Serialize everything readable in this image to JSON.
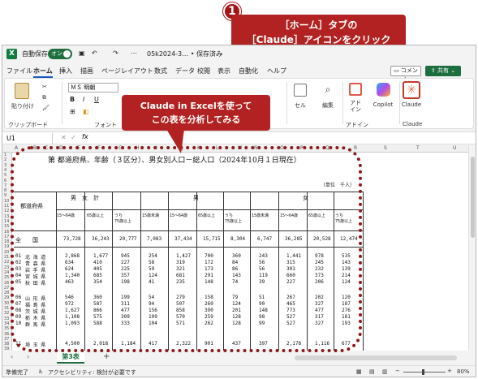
{
  "callout_main": {
    "badge": "1",
    "line1": "［ホーム］タブの",
    "line2": "［Claude］アイコンをクリック"
  },
  "callout_sub": {
    "line1": "Claude in Excelを使って",
    "line2": "この表を分析してみる"
  },
  "titlebar": {
    "autosave": "自動保存",
    "toggle": "オン",
    "filename": "05k2024-3… • 保存済み",
    "dropdown": "⌄"
  },
  "menu": {
    "items": [
      "ファイル",
      "ホーム",
      "挿入",
      "描画",
      "ページレイアウト",
      "数式",
      "データ",
      "校閲",
      "表示",
      "自動化",
      "ヘルプ"
    ],
    "comment": "コメント",
    "share": "共有"
  },
  "ribbon": {
    "paste": "貼り付け",
    "clipboard": "クリップボード",
    "font_name": "ＭＳ 明朝",
    "font_group": "フォント",
    "cells": "セル",
    "editing": "編集",
    "addins": "アド\nイン",
    "copilot": "Copilot",
    "claude": "Claude",
    "addins_group": "アドイン",
    "claude_group": "Claude"
  },
  "formula": {
    "namebox": "U1",
    "fx": "fx"
  },
  "columns": [
    "A",
    "B",
    "C",
    "D",
    "E",
    "F",
    "G",
    "H",
    "I",
    "J",
    "K",
    "L",
    "M",
    "N",
    "O",
    "P",
    "Q",
    "R",
    "S",
    "T",
    "U"
  ],
  "rows": [
    "1",
    "2",
    "3",
    "4",
    "5",
    "6",
    "7",
    "8",
    "9",
    "10",
    "11",
    "12",
    "13",
    "14",
    "15",
    "16",
    "17",
    "18",
    "19",
    "20",
    "21",
    "22",
    "23",
    "24",
    "25",
    "26",
    "27",
    "28",
    "29",
    "30",
    "31",
    "32",
    "33",
    "34",
    "35",
    "36",
    "37",
    "38",
    "39"
  ],
  "table": {
    "title": "第 都道府県、年齢（３区分）、男女別人口－総人口（2024年10月１日現在）",
    "unit": "（単位　千人）",
    "header_pref": "都道府県",
    "header_total": "男　女　計",
    "header_male": "男",
    "header_female": "女",
    "sub": [
      "15～64歳",
      "65歳以上",
      "うち\n75歳以上",
      "15歳未満",
      "15～64歳",
      "65歳以上",
      "うち\n75歳以上",
      "15歳未満",
      "15～64歳",
      "65歳以上",
      "うち\n75歳以上"
    ],
    "national": {
      "name": "全　　国",
      "values": [
        "73,728",
        "36,243",
        "20,777",
        "7,083",
        "37,434",
        "15,715",
        "8,304",
        "6,747",
        "36,285",
        "20,528",
        "12,474"
      ]
    },
    "block1": [
      {
        "code": "01",
        "name": "北 海 道",
        "values": [
          "2,868",
          "1,677",
          "945",
          "254",
          "1,427",
          "700",
          "360",
          "243",
          "1,441",
          "978",
          "535"
        ]
      },
      {
        "code": "02",
        "name": "青 森 県",
        "values": [
          "634",
          "410",
          "227",
          "58",
          "319",
          "172",
          "84",
          "56",
          "315",
          "245",
          "143"
        ]
      },
      {
        "code": "03",
        "name": "岩 手 県",
        "values": [
          "624",
          "405",
          "225",
          "59",
          "321",
          "173",
          "86",
          "56",
          "303",
          "232",
          "139"
        ]
      },
      {
        "code": "04",
        "name": "宮 城 県",
        "values": [
          "1,340",
          "685",
          "357",
          "124",
          "681",
          "291",
          "143",
          "119",
          "660",
          "373",
          "214"
        ]
      },
      {
        "code": "05",
        "name": "秋 田 県",
        "values": [
          "463",
          "354",
          "198",
          "41",
          "235",
          "148",
          "74",
          "39",
          "227",
          "206",
          "124"
        ]
      }
    ],
    "block2": [
      {
        "code": "06",
        "name": "山 形 県",
        "values": [
          "546",
          "360",
          "199",
          "54",
          "279",
          "158",
          "79",
          "51",
          "267",
          "202",
          "120"
        ]
      },
      {
        "code": "07",
        "name": "福 島 県",
        "values": [
          "972",
          "587",
          "311",
          "94",
          "507",
          "260",
          "124",
          "90",
          "465",
          "327",
          "187"
        ]
      },
      {
        "code": "08",
        "name": "茨 城 県",
        "values": [
          "1,627",
          "866",
          "477",
          "156",
          "858",
          "390",
          "201",
          "148",
          "773",
          "477",
          "276"
        ]
      },
      {
        "code": "09",
        "name": "栃 木 県",
        "values": [
          "1,108",
          "575",
          "309",
          "109",
          "570",
          "259",
          "128",
          "98",
          "527",
          "317",
          "181"
        ]
      },
      {
        "code": "10",
        "name": "群 馬 県",
        "values": [
          "1,093",
          "588",
          "333",
          "104",
          "571",
          "262",
          "128",
          "99",
          "527",
          "327",
          "193"
        ]
      }
    ],
    "partial": {
      "code": "11",
      "name": "埼 玉 県",
      "values": [
        "4,500",
        "2,018",
        "1,184",
        "417",
        "2,322",
        "901",
        "437",
        "397",
        "2,178",
        "1,116",
        "677"
      ]
    }
  },
  "tabs": {
    "sheet": "第3表",
    "add": "+"
  },
  "status": {
    "ready": "準備完了",
    "accessibility": "アクセシビリティ: 検討が必要です",
    "zoom": "80%"
  }
}
